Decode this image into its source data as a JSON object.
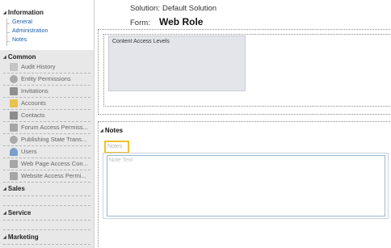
{
  "header": {
    "solution_label": "Solution:",
    "solution_value": "Default Solution",
    "form_label": "Form:",
    "form_value": "Web Role"
  },
  "sidebar": {
    "information": {
      "title": "Information",
      "links": [
        "General",
        "Administration",
        "Notes"
      ]
    },
    "common": {
      "title": "Common",
      "items": [
        {
          "label": "Audit History",
          "icon": "audit-history-icon",
          "color": "#b9b9b9"
        },
        {
          "label": "Entity Permissions",
          "icon": "gear-icon",
          "color": "#9e9e9e"
        },
        {
          "label": "Invitations",
          "icon": "invitation-icon",
          "color": "#8d8d8d"
        },
        {
          "label": "Accounts",
          "icon": "folder-icon",
          "color": "#e8c34a"
        },
        {
          "label": "Contacts",
          "icon": "contact-card-icon",
          "color": "#8c8c8c"
        },
        {
          "label": "Forum Access Permiss...",
          "icon": "forum-permission-icon",
          "color": "#a6a6a6"
        },
        {
          "label": "Publishing State Trans...",
          "icon": "gear-icon",
          "color": "#9e9e9e"
        },
        {
          "label": "Users",
          "icon": "users-icon",
          "color": "#7b9fca"
        },
        {
          "label": "Web Page Access Con...",
          "icon": "lock-icon",
          "color": "#a6a6a6"
        },
        {
          "label": "Website Access Permi...",
          "icon": "lock-icon",
          "color": "#a6a6a6"
        }
      ]
    },
    "sales": {
      "title": "Sales"
    },
    "service": {
      "title": "Service"
    },
    "marketing": {
      "title": "Marketing"
    }
  },
  "main": {
    "content_access_levels_label": "Content Access Levels",
    "notes_section_title": "Notes",
    "notes_tab_label": "Notes",
    "note_text_placeholder": "Note Text"
  },
  "colors": {
    "link": "#1c5fa8",
    "tab_highlight": "#f2c12e",
    "sidebar_bg": "#e8e8e8"
  }
}
